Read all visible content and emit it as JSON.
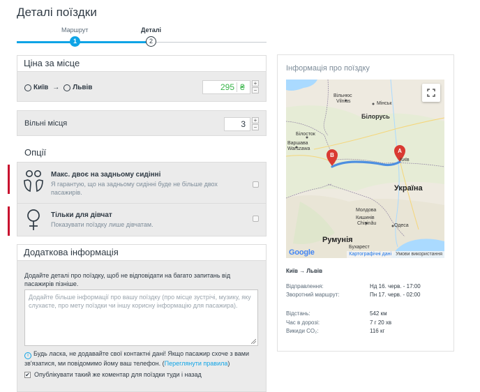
{
  "page": {
    "title": "Деталі поїздки"
  },
  "stepper": {
    "step1_label": "Маршрут",
    "step1_number": "1",
    "step2_label": "Деталі",
    "step2_number": "2",
    "accent": "#0fa4e6"
  },
  "price": {
    "heading": "Ціна за місце",
    "from": "Київ",
    "to": "Львів",
    "arrow": "→",
    "value": "295",
    "currency": "₴",
    "plus": "+",
    "minus": "−",
    "value_color": "#39b54a"
  },
  "seats": {
    "label": "Вільні місця",
    "value": "3",
    "plus": "+",
    "minus": "−"
  },
  "options": {
    "heading": "Опції",
    "items": [
      {
        "title": "Макс. двоє на задньому сидінні",
        "description": "Я гарантую, що на задньому сидінні буде не більше двох пасажирів.",
        "checked": false,
        "icon": "two-people-icon"
      },
      {
        "title": "Тільки для дівчат",
        "description": "Показувати поїздку лише дівчатам.",
        "checked": false,
        "icon": "female-symbol-icon"
      }
    ],
    "marker_color": "#c8102e"
  },
  "extra": {
    "heading": "Додаткова інформація",
    "intro": "Додайте деталі про поїздку, щоб не відповідати на багато запитань від пасажирів пізніше.",
    "placeholder": "Додайте більше інформації про вашу поїздку (про місце зустрічі, музику, яку слухаєте, про мету поїздки чи іншу корисну інформацію для пасажира).",
    "notice_text": "Будь ласка, не додавайте свої контактні дані! Якщо пасажир схоче з вами зв'язатися, ми повідомимо йому ваш телефон.",
    "notice_open": "(",
    "notice_link": "Переглянути правила",
    "notice_close": ")",
    "publish_label": "Опублікувати такий же коментар для поїздки туди і назад",
    "publish_checked": true,
    "check_glyph": "✔",
    "info_glyph": "i"
  },
  "trip_info": {
    "heading": "Інформація про поїздку",
    "map": {
      "labels": {
        "vilnius": "Вільнюс",
        "vilnius_lt": "Vilnius",
        "minsk": "Мінськ",
        "belarus": "Білорусь",
        "bialystok": "Білосток",
        "warsaw": "Варшава",
        "warsaw_pl": "Warszawa",
        "kyiv": "Київ",
        "ukraine": "Україна",
        "moldova": "Молдова",
        "chisinau": "Кишинів",
        "chisinau_ro": "Chișinău",
        "odesa": "Одеса",
        "romania": "Румунія",
        "bucharest": "Бухарест"
      },
      "google": "Google",
      "attribution_data": "Картографічні дані",
      "attribution_terms": "Умови використання",
      "fullscreen": "fullscreen-icon"
    },
    "route": "Київ → Львів",
    "departure_label": "Відправлення:",
    "departure_value": "Нд 16. черв. - 17:00",
    "return_label": "Зворотний маршрут:",
    "return_value": "Пн 17. черв. - 02:00",
    "distance_label": "Відстань:",
    "distance_value": "542 км",
    "duration_label": "Час в дорозі:",
    "duration_value": "7 г 20 хв",
    "co2_label": "Викиди CO₂:",
    "co2_value": "116 кг"
  }
}
